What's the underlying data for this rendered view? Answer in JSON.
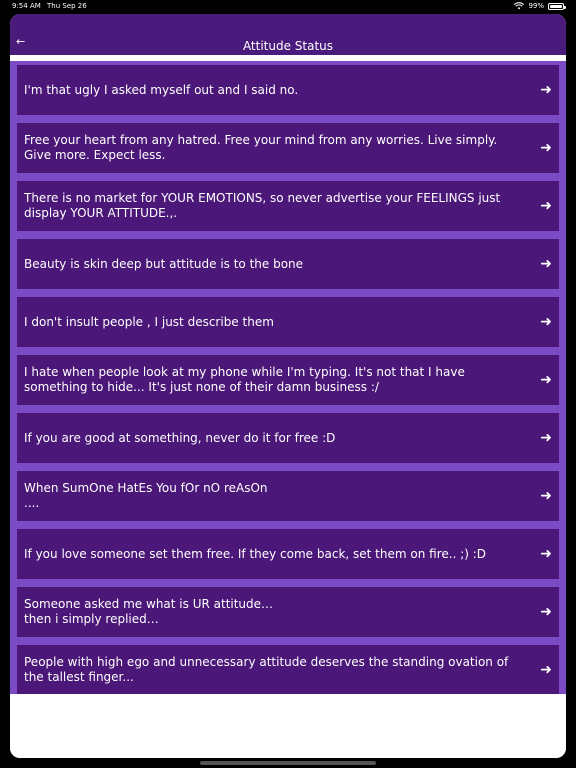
{
  "status": {
    "time": "9:54 AM",
    "date": "Thu Sep 26",
    "battery": "99%",
    "icons": [
      "wifi-icon",
      "battery-icon"
    ]
  },
  "nav": {
    "back_glyph": "←",
    "title": "Attitude Status"
  },
  "colors": {
    "nav_bg": "#4b1a7d",
    "item_bg": "#4b1778",
    "list_bg": "#7a4bc4"
  },
  "items": [
    {
      "text": "I'm that ugly I asked myself out and I said no.",
      "arrow": "➜"
    },
    {
      "text": "Free your heart from any hatred. Free your mind from any worries. Live simply. Give more. Expect less.",
      "arrow": "➜"
    },
    {
      "text": "There is no market for YOUR EMOTIONS, so never advertise your FEELINGS just display YOUR ATTITUDE.,.",
      "arrow": "➜"
    },
    {
      "text": "Beauty is skin deep but attitude is to the bone",
      "arrow": "➜"
    },
    {
      "text": "I don't insult people , I just describe them",
      "arrow": "➜"
    },
    {
      "text": "I hate when people look at my phone while I'm typing. It's not that I have something to hide... It's just none of their damn business :/",
      "arrow": "➜"
    },
    {
      "text": "If you are good at something, never do it for free :D",
      "arrow": "➜"
    },
    {
      "text": "When SumOne HatEs You fOr nO reAsOn\n....",
      "arrow": "➜"
    },
    {
      "text": "If you love someone set them free. If they come back, set them on fire.. ;) :D",
      "arrow": "➜"
    },
    {
      "text": "Someone asked me what is UR attitude…\nthen i simply replied…",
      "arrow": "➜"
    },
    {
      "text": "People with high ego and unnecessary attitude deserves the standing ovation of the tallest finger...",
      "arrow": "➜"
    }
  ]
}
